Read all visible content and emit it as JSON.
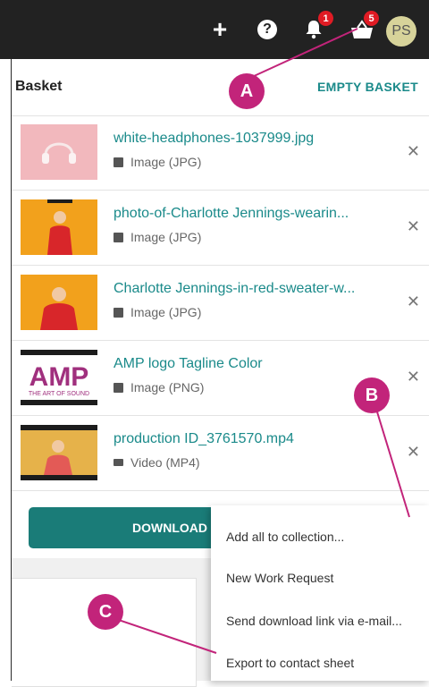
{
  "topbar": {
    "add_icon": "plus-icon",
    "help_icon": "question-icon",
    "notifications": {
      "icon": "bell-icon",
      "count": "1"
    },
    "basket": {
      "icon": "basket-icon",
      "count": "5"
    },
    "avatar": "PS"
  },
  "panel": {
    "title": "Basket",
    "empty_label": "EMPTY BASKET",
    "items": [
      {
        "name": "white-headphones-1037999.jpg",
        "type": "Image (JPG)",
        "type_icon": "image-icon"
      },
      {
        "name": "photo-of-Charlotte Jennings-wearin...",
        "type": "Image (JPG)",
        "type_icon": "image-icon"
      },
      {
        "name": "Charlotte Jennings-in-red-sweater-w...",
        "type": "Image (JPG)",
        "type_icon": "image-icon"
      },
      {
        "name": "AMP logo Tagline Color",
        "type": "Image (PNG)",
        "type_icon": "image-icon"
      },
      {
        "name": "production ID_3761570.mp4",
        "type": "Video (MP4)",
        "type_icon": "video-icon"
      }
    ],
    "download_label": "DOWNLOAD"
  },
  "menu": {
    "items": [
      "Add all to collection...",
      "New Work Request",
      "Send download link via e-mail...",
      "Export to contact sheet"
    ]
  },
  "callouts": {
    "a": "A",
    "b": "B",
    "c": "C"
  },
  "logo": {
    "amp_text": "AMP",
    "tagline": "THE ART OF SOUND"
  },
  "colors": {
    "accent": "#1a8a8a",
    "button": "#1a7c78",
    "callout": "#c2247a",
    "badge": "#e01b24",
    "topbar": "#222222"
  }
}
